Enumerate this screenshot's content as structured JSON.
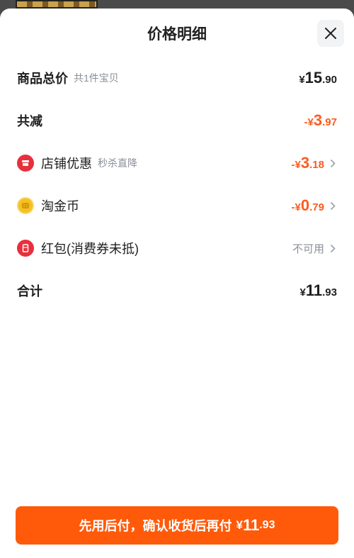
{
  "colors": {
    "accent": "#ff5a0a",
    "discount": "#ff5a1f",
    "muted": "#8a8f99"
  },
  "header": {
    "title": "价格明细",
    "close_icon": "close-icon"
  },
  "rows": {
    "subtotal": {
      "label": "商品总价",
      "sublabel": "共1件宝贝",
      "yen": "¥",
      "int": "15",
      "dec": ".90"
    },
    "reduction": {
      "label": "共减",
      "sign": "-",
      "yen": "¥",
      "int": "3",
      "dec": ".97"
    },
    "store": {
      "icon": "store-icon",
      "label": "店铺优惠",
      "sublabel": "秒杀直降",
      "sign": "-",
      "yen": "¥",
      "int": "3",
      "dec": ".18"
    },
    "coins": {
      "icon": "coin-icon",
      "label": "淘金币",
      "sign": "-",
      "yen": "¥",
      "int": "0",
      "dec": ".79"
    },
    "redpacket": {
      "icon": "red-packet-icon",
      "label": "红包(消费券未抵)",
      "status": "不可用"
    },
    "total": {
      "label": "合计",
      "yen": "¥",
      "int": "11",
      "dec": ".93"
    }
  },
  "cta": {
    "text": "先用后付，确认收货后再付",
    "yen": "¥",
    "int": "11",
    "dec": ".93"
  }
}
